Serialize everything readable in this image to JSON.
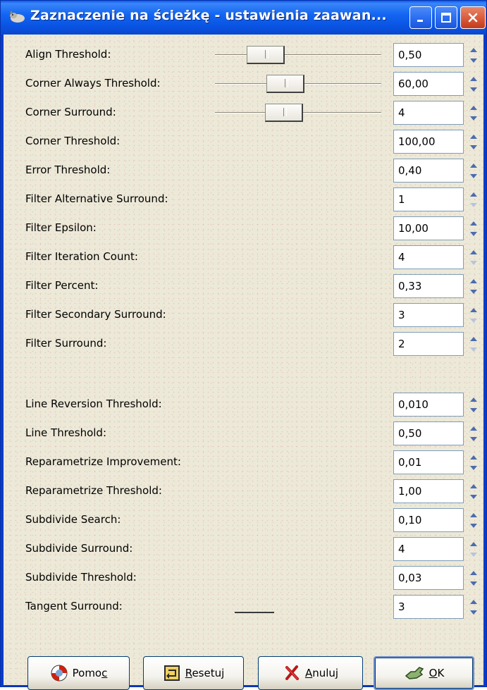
{
  "window": {
    "title": "Zaznaczenie na ścieżkę - ustawienia zaawan..."
  },
  "settings": [
    {
      "label": "Align Threshold:",
      "value": "0,50",
      "slider": 0.19,
      "up": true,
      "down": true
    },
    {
      "label": "Corner Always Threshold:",
      "value": "60,00",
      "slider": 0.31,
      "up": true,
      "down": true
    },
    {
      "label": "Corner Surround:",
      "value": "4",
      "slider": 0.3,
      "up": true,
      "down": true
    },
    {
      "label": "Corner Threshold:",
      "value": "100,00",
      "up": true,
      "down": true
    },
    {
      "label": "Error Threshold:",
      "value": "0,40",
      "up": true,
      "down": true
    },
    {
      "label": "Filter Alternative Surround:",
      "value": "1",
      "up": true,
      "down": false
    },
    {
      "label": "Filter Epsilon:",
      "value": "10,00",
      "up": true,
      "down": true
    },
    {
      "label": "Filter Iteration Count:",
      "value": "4",
      "up": true,
      "down": false
    },
    {
      "label": "Filter Percent:",
      "value": "0,33",
      "up": true,
      "down": true
    },
    {
      "label": "Filter Secondary Surround:",
      "value": "3",
      "up": true,
      "down": false
    },
    {
      "label": "Filter Surround:",
      "value": "2",
      "up": true,
      "down": false
    },
    {
      "label": "Line Reversion Threshold:",
      "value": "0,010",
      "up": true,
      "down": true
    },
    {
      "label": "Line Threshold:",
      "value": "0,50",
      "up": true,
      "down": true
    },
    {
      "label": "Reparametrize Improvement:",
      "value": "0,01",
      "up": true,
      "down": true
    },
    {
      "label": "Reparametrize Threshold:",
      "value": "1,00",
      "up": true,
      "down": true
    },
    {
      "label": "Subdivide Search:",
      "value": "0,10",
      "up": true,
      "down": true
    },
    {
      "label": "Subdivide Surround:",
      "value": "4",
      "up": true,
      "down": false
    },
    {
      "label": "Subdivide Threshold:",
      "value": "0,03",
      "up": true,
      "down": true
    },
    {
      "label": "Tangent Surround:",
      "value": "3",
      "up": true,
      "down": true
    }
  ],
  "buttons": {
    "help": {
      "prefix": "Pomo",
      "mnemonic": "c",
      "suffix": "",
      "icon": "lifebuoy-icon"
    },
    "reset": {
      "prefix": "",
      "mnemonic": "R",
      "suffix": "esetuj",
      "icon": "reset-icon"
    },
    "cancel": {
      "prefix": "",
      "mnemonic": "A",
      "suffix": "nuluj",
      "icon": "cancel-x-icon"
    },
    "ok": {
      "prefix": "",
      "mnemonic": "O",
      "suffix": "K",
      "icon": "ok-hand-icon"
    }
  }
}
